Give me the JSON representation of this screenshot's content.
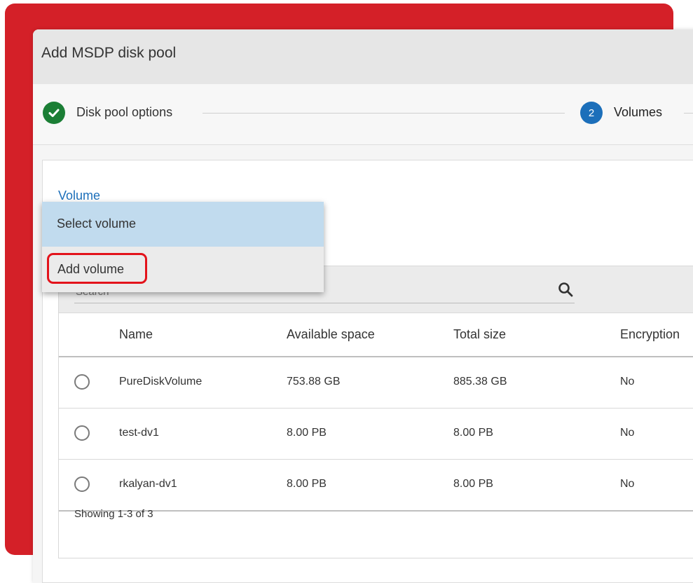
{
  "colors": {
    "brand_red": "#d42028",
    "step_done": "#1b7e35",
    "step_active": "#1c6fba",
    "dropdown_selected": "#c1dbee",
    "highlight": "#e3131b"
  },
  "dialog": {
    "title": "Add MSDP disk pool"
  },
  "stepper": {
    "steps": [
      {
        "label": "Disk pool options",
        "status": "done",
        "icon": "check-icon"
      },
      {
        "number": "2",
        "label": "Volumes",
        "status": "active"
      }
    ]
  },
  "volume_field": {
    "label": "Volume",
    "dropdown": {
      "selected": "Select volume",
      "options": [
        "Add volume"
      ]
    }
  },
  "table": {
    "search": {
      "placeholder": "Search",
      "icon": "search-icon"
    },
    "columns": [
      "Name",
      "Available space",
      "Total size",
      "Encryption"
    ],
    "rows": [
      {
        "name": "PureDiskVolume",
        "available": "753.88 GB",
        "total": "885.38 GB",
        "encryption": "No"
      },
      {
        "name": "test-dv1",
        "available": "8.00 PB",
        "total": "8.00 PB",
        "encryption": "No"
      },
      {
        "name": "rkalyan-dv1",
        "available": "8.00 PB",
        "total": "8.00 PB",
        "encryption": "No"
      }
    ],
    "footer": "Showing 1-3 of 3"
  }
}
